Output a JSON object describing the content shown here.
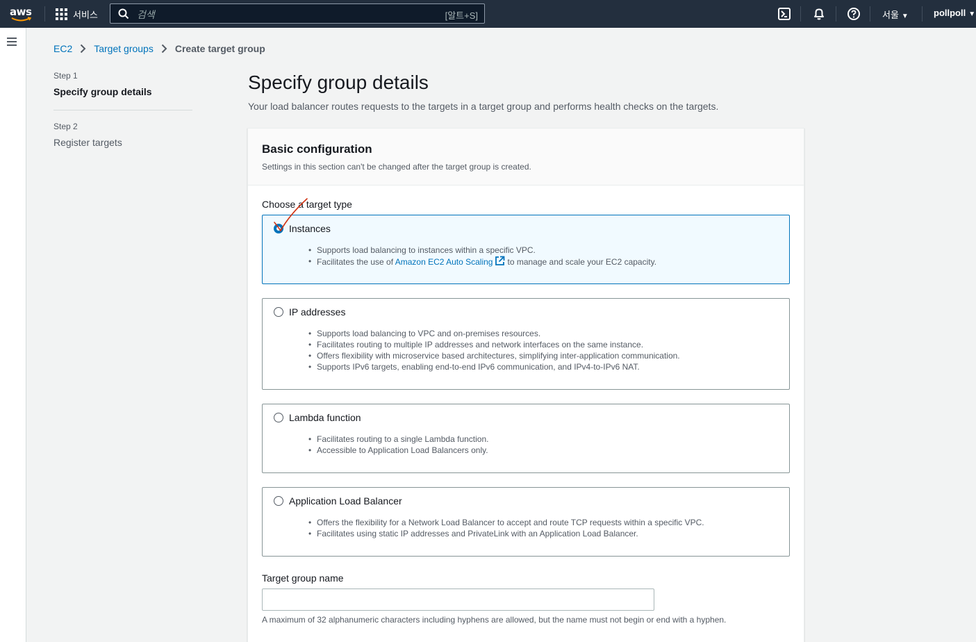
{
  "topnav": {
    "logo_text": "aws",
    "services_label": "서비스",
    "search_placeholder": "검색",
    "search_shortcut": "[알트+S]",
    "region": "서울",
    "user": "pollpoll",
    "icons": [
      "cloudshell-icon",
      "bell-icon",
      "help-icon"
    ]
  },
  "breadcrumb": {
    "items": [
      "EC2",
      "Target groups"
    ],
    "current": "Create target group"
  },
  "steps": [
    {
      "num": "Step 1",
      "title": "Specify group details"
    },
    {
      "num": "Step 2",
      "title": "Register targets"
    }
  ],
  "page": {
    "title": "Specify group details",
    "description": "Your load balancer routes requests to the targets in a target group and performs health checks on the targets."
  },
  "basic_config": {
    "title": "Basic configuration",
    "description": "Settings in this section can't be changed after the target group is created.",
    "target_type_label": "Choose a target type",
    "options": [
      {
        "label": "Instances",
        "selected": true,
        "bullets": [
          "Supports load balancing to instances within a specific VPC."
        ],
        "bullet2_pre": "Facilitates the use of ",
        "bullet2_link": "Amazon EC2 Auto Scaling",
        "bullet2_post": "to manage and scale your EC2 capacity."
      },
      {
        "label": "IP addresses",
        "selected": false,
        "bullets": [
          "Supports load balancing to VPC and on-premises resources.",
          "Facilitates routing to multiple IP addresses and network interfaces on the same instance.",
          "Offers flexibility with microservice based architectures, simplifying inter-application communication.",
          "Supports IPv6 targets, enabling end-to-end IPv6 communication, and IPv4-to-IPv6 NAT."
        ]
      },
      {
        "label": "Lambda function",
        "selected": false,
        "bullets": [
          "Facilitates routing to a single Lambda function.",
          "Accessible to Application Load Balancers only."
        ]
      },
      {
        "label": "Application Load Balancer",
        "selected": false,
        "bullets": [
          "Offers the flexibility for a Network Load Balancer to accept and route TCP requests within a specific VPC.",
          "Facilitates using static IP addresses and PrivateLink with an Application Load Balancer."
        ]
      }
    ],
    "name_label": "Target group name",
    "name_value": "",
    "name_hint": "A maximum of 32 alphanumeric characters including hyphens are allowed, but the name must not begin or end with a hyphen."
  },
  "colors": {
    "nav_bg": "#232f3e",
    "link": "#0073bb",
    "selected_tile_bg": "#f1faff",
    "annotation_check": "#d13212"
  }
}
